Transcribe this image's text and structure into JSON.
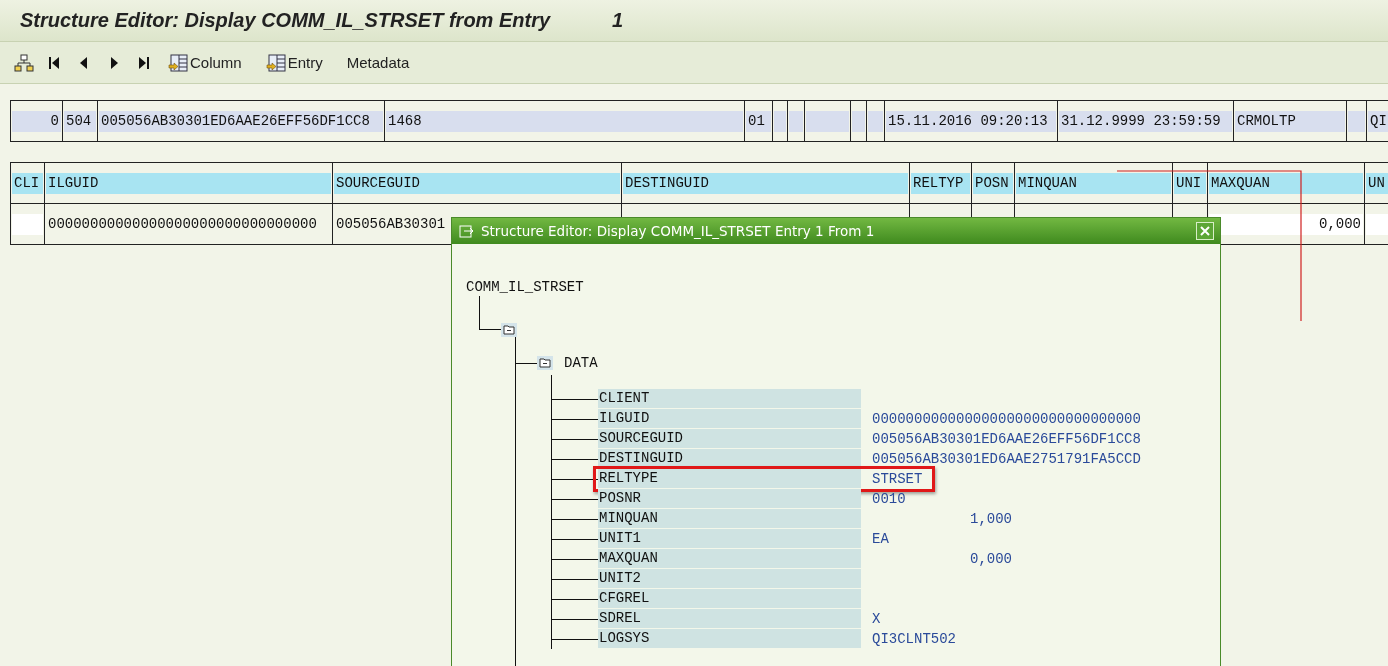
{
  "window": {
    "title": "Structure Editor: Display COMM_IL_STRSET from Entry",
    "entry": "1"
  },
  "toolbar": [
    {
      "kind": "icon-label",
      "label": "Column"
    },
    {
      "kind": "icon-label",
      "label": "Entry"
    },
    {
      "kind": "label",
      "label": "Metadata"
    }
  ],
  "record": {
    "cells": [
      {
        "text": "0"
      },
      {
        "text": "504"
      },
      {
        "text": "005056AB30301ED6AAE26EFF56DF1CC8"
      },
      {
        "text": "1468"
      },
      {
        "text": "01"
      },
      {},
      {},
      {},
      {},
      {},
      {
        "text": "15.11.2016 09:20:13"
      },
      {
        "text": "31.12.9999 23:59:59"
      },
      {
        "text": "CRMOLTP"
      },
      {},
      {
        "text": "QI"
      }
    ]
  },
  "table": {
    "columns": [
      "CLI",
      "ILGUID",
      "SOURCEGUID",
      "DESTINGUID",
      "RELTYP",
      "POSN",
      "MINQUAN",
      "UNI",
      "MAXQUAN",
      "UN"
    ],
    "rows": [
      [
        {},
        {
          "text": "00000000000000000000000000000000"
        },
        {
          "text": "005056AB30301"
        },
        {},
        {},
        {},
        {},
        {},
        {
          "text": "0,000",
          "kind": "number"
        },
        {}
      ]
    ]
  },
  "dialog": {
    "title": "Structure Editor: Display COMM_IL_STRSET Entry 1 From 1",
    "tree": {
      "label": "COMM_IL_STRSET",
      "children": [
        {
          "expanded": true,
          "children": [
            {
              "label": "DATA",
              "expanded": true,
              "fields": [
                {
                  "name": "CLIENT",
                  "highlighted": false
                },
                {
                  "name": "ILGUID",
                  "value": "00000000000000000000000000000000",
                  "kind": "text",
                  "highlighted": false
                },
                {
                  "name": "SOURCEGUID",
                  "value": "005056AB30301ED6AAE26EFF56DF1CC8",
                  "kind": "text",
                  "highlighted": false
                },
                {
                  "name": "DESTINGUID",
                  "value": "005056AB30301ED6AAE2751791FA5CCD",
                  "kind": "text",
                  "highlighted": false
                },
                {
                  "name": "RELTYPE",
                  "value": "STRSET",
                  "kind": "text",
                  "highlighted": true
                },
                {
                  "name": "POSNR",
                  "value": "0010",
                  "kind": "text",
                  "highlighted": false
                },
                {
                  "name": "MINQUAN",
                  "value": "1,000",
                  "kind": "number",
                  "highlighted": false
                },
                {
                  "name": "UNIT1",
                  "value": "EA",
                  "kind": "text",
                  "highlighted": false
                },
                {
                  "name": "MAXQUAN",
                  "value": "0,000",
                  "kind": "number",
                  "highlighted": false
                },
                {
                  "name": "UNIT2",
                  "highlighted": false
                },
                {
                  "name": "CFGREL",
                  "highlighted": false
                },
                {
                  "name": "SDREL",
                  "value": "X",
                  "kind": "text",
                  "highlighted": false
                },
                {
                  "name": "LOGSYS",
                  "value": "QI3CLNT502",
                  "kind": "text",
                  "highlighted": false
                }
              ]
            }
          ]
        }
      ]
    }
  }
}
